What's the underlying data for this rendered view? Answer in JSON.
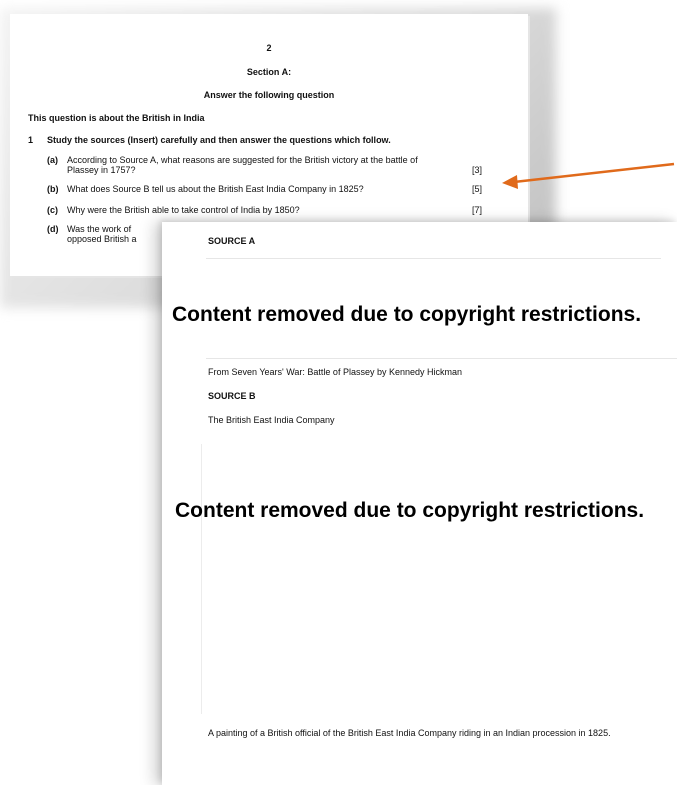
{
  "page1": {
    "page_number": "2",
    "section": "Section A:",
    "instruction": "Answer the following question",
    "topic": "This question is about the British in India",
    "question_number": "1",
    "question_stem": "Study the sources (Insert) carefully and then answer the questions which follow.",
    "parts": [
      {
        "label": "(a)",
        "text_line1": "According to Source A, what reasons are suggested for the British victory at the battle of",
        "text_line2": "Plassey in 1757?",
        "marks": "[3]"
      },
      {
        "label": "(b)",
        "text": "What does Source B tell us about the British East India Company in 1825?",
        "marks": "[5]"
      },
      {
        "label": "(c)",
        "text": "Why were the British able to take control of India by 1850?",
        "marks": "[7]"
      },
      {
        "label": "(d)",
        "text_line1": "Was the work of",
        "text_line2": "opposed British a"
      }
    ]
  },
  "page2": {
    "source_a_heading": "SOURCE A",
    "removed_notice_1": "Content removed due to copyright restrictions.",
    "source_a_caption": "From Seven Years' War: Battle of Plassey by Kennedy Hickman",
    "source_b_heading": "SOURCE B",
    "source_b_title": "The British East India Company",
    "removed_notice_2": "Content removed due to copyright restrictions.",
    "source_b_caption": "A painting of a British official of the British East India Company riding in an Indian procession in 1825."
  },
  "colors": {
    "arrow": "#e06a1b"
  }
}
